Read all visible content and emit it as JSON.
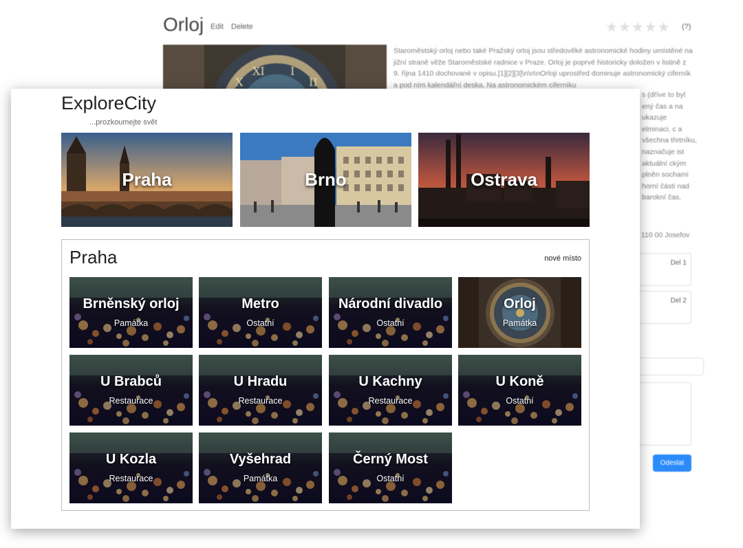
{
  "back_window": {
    "title": "Orloj",
    "edit_label": "Edit",
    "delete_label": "Delete",
    "stars": "★★★★★",
    "rating_count": "(?)",
    "description": "Staroměstský orloj nebo také Pražský orloj jsou středověké astronomické hodiny umístěné na jižní straně věže Staroměstské radnice v Praze. Orloj je poprvé historicky doložen v listině z 9. října 1410 dochované v opisu.[1][2][3]\\n\\n\\nOrloji uprostřed dominuje astronomický ciferník a pod ním kalendářní deska. Na astronomickém ciferníku",
    "description_tail": "s (dříve to byl ený čas a na ukazuje elminaci, c a všechna třetníku, naznačuje ist aktuální ckým plněn sochami horní části nad barokní čas.",
    "address": "110 00 Josefov",
    "comments": [
      {
        "delete_label": "Del 1"
      },
      {
        "delete_label": "Del 2"
      }
    ],
    "send_label": "Odeslat"
  },
  "app": {
    "brand": "ExploreCity",
    "tagline": "...prozkoumejte svět"
  },
  "cities": [
    {
      "name": "Praha"
    },
    {
      "name": "Brno"
    },
    {
      "name": "Ostrava"
    }
  ],
  "panel": {
    "title": "Praha",
    "new_place_label": "nové místo"
  },
  "places": [
    {
      "name": "Brněnský orloj",
      "type": "Památka"
    },
    {
      "name": "Metro",
      "type": "Ostatní"
    },
    {
      "name": "Národní divadlo",
      "type": "Ostatní"
    },
    {
      "name": "Orloj",
      "type": "Památka"
    },
    {
      "name": "U Brabců",
      "type": "Restaurace"
    },
    {
      "name": "U Hradu",
      "type": "Restaurace"
    },
    {
      "name": "U Kachny",
      "type": "Restaurace"
    },
    {
      "name": "U Koně",
      "type": "Ostatní"
    },
    {
      "name": "U Kozla",
      "type": "Restaurace"
    },
    {
      "name": "Vyšehrad",
      "type": "Památka"
    },
    {
      "name": "Černý Most",
      "type": "Ostatní"
    }
  ],
  "colors": {
    "accent_button": "#1a82fb",
    "card_dark": "#0c0a1e"
  },
  "icons": {
    "card_background": "bokeh-lights-image",
    "orloj_background": "astronomical-clock-image"
  }
}
